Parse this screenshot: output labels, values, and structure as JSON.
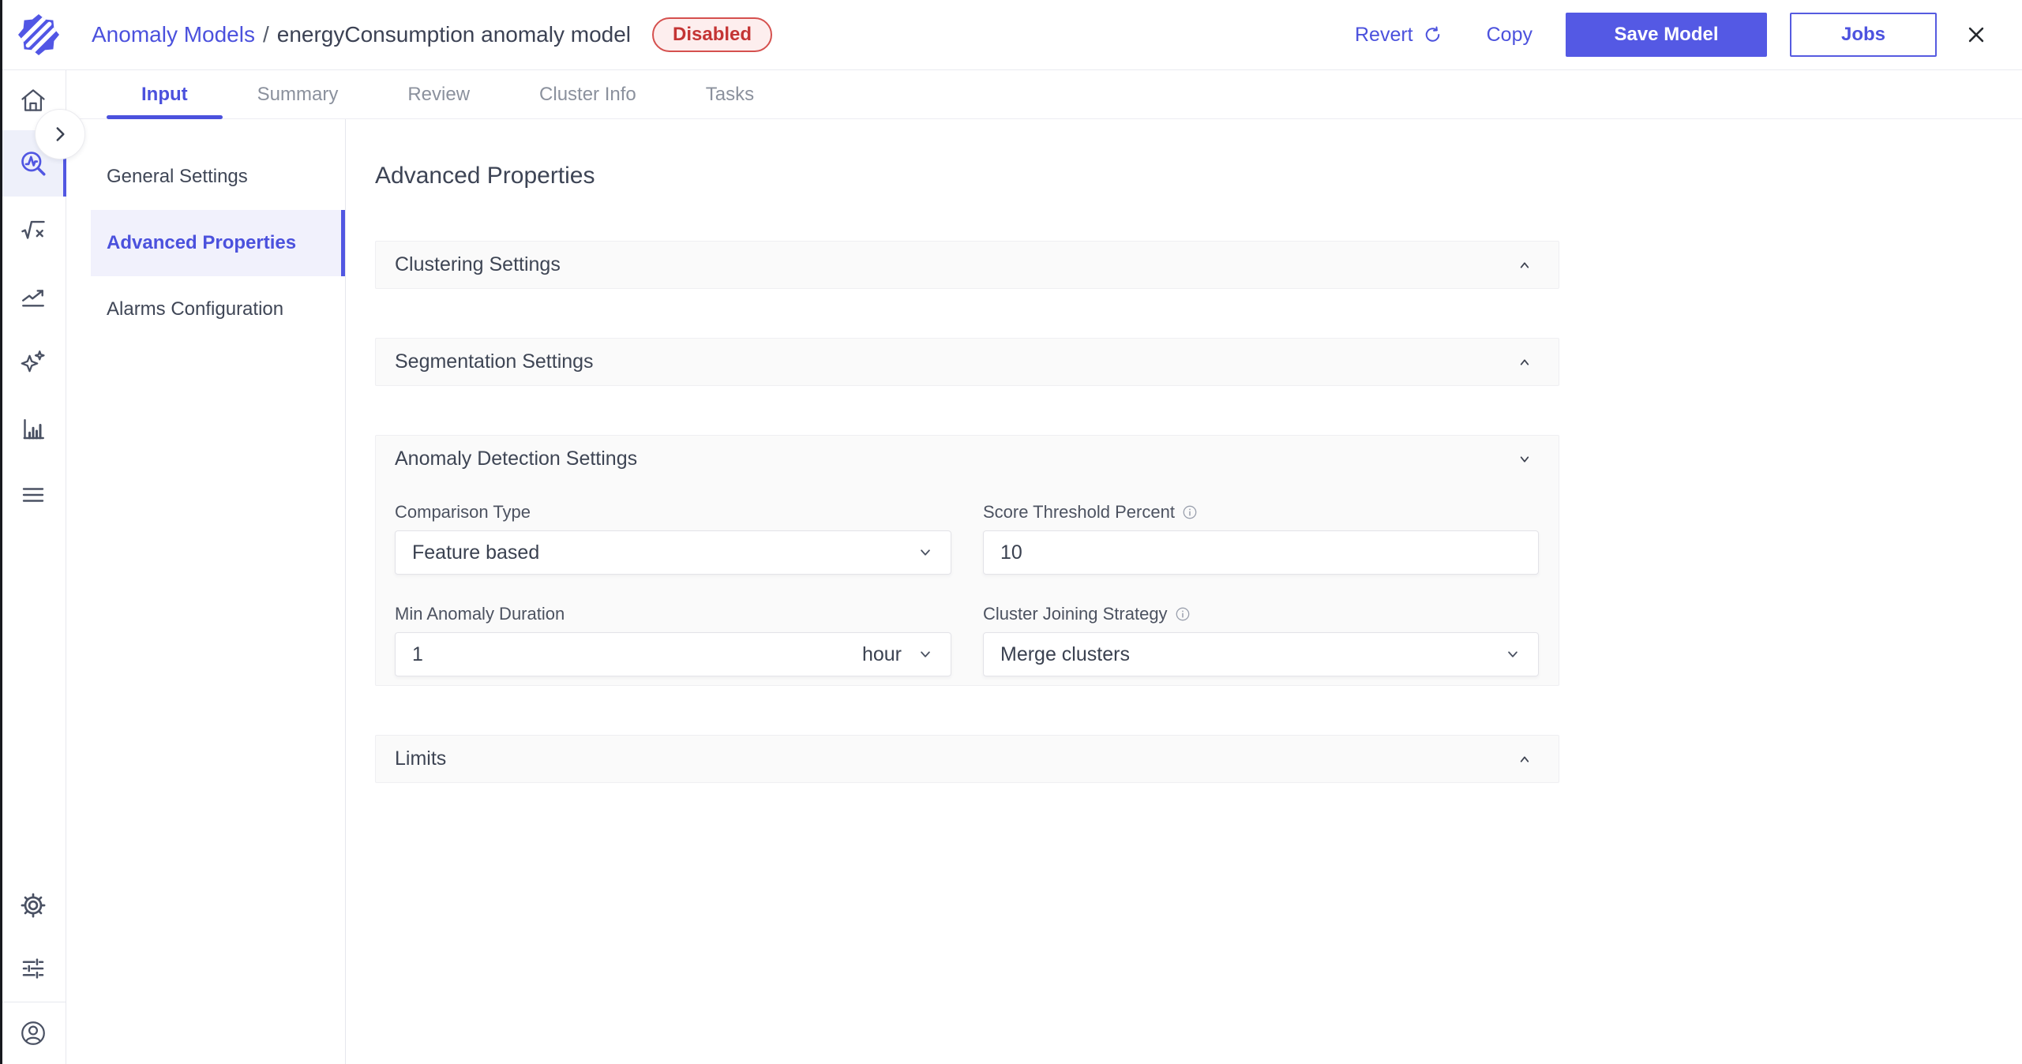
{
  "header": {
    "breadcrumb": {
      "parent": "Anomaly Models",
      "separator": "/",
      "current": "energyConsumption anomaly model"
    },
    "status_badge": "Disabled",
    "actions": {
      "revert": "Revert",
      "copy": "Copy",
      "save": "Save Model",
      "jobs": "Jobs"
    }
  },
  "tabs": [
    {
      "label": "Input",
      "active": true
    },
    {
      "label": "Summary",
      "active": false
    },
    {
      "label": "Review",
      "active": false
    },
    {
      "label": "Cluster Info",
      "active": false
    },
    {
      "label": "Tasks",
      "active": false
    }
  ],
  "sidebar": {
    "top_icons": [
      "home-icon",
      "anomaly-search-icon",
      "formula-icon",
      "trend-icon",
      "sparkles-icon",
      "bar-chart-icon",
      "menu-icon"
    ],
    "active_icon": "anomaly-search-icon",
    "bottom_icons": [
      "settings-gear-icon",
      "sliders-icon",
      "account-icon"
    ],
    "expand_icon": "chevron-right-icon"
  },
  "subnav": {
    "items": [
      {
        "label": "General Settings",
        "active": false
      },
      {
        "label": "Advanced Properties",
        "active": true
      },
      {
        "label": "Alarms Configuration",
        "active": false
      }
    ]
  },
  "main": {
    "title": "Advanced Properties",
    "sections": [
      {
        "title": "Clustering Settings",
        "expanded": false
      },
      {
        "title": "Segmentation Settings",
        "expanded": false
      },
      {
        "title": "Anomaly Detection Settings",
        "expanded": true,
        "fields": [
          {
            "label": "Comparison Type",
            "type": "select",
            "value": "Feature based",
            "info": false
          },
          {
            "label": "Score Threshold Percent",
            "type": "input",
            "value": "10",
            "info": true
          },
          {
            "label": "Min Anomaly Duration",
            "type": "input-unit",
            "value": "1",
            "unit": "hour",
            "info": false
          },
          {
            "label": "Cluster Joining Strategy",
            "type": "select",
            "value": "Merge clusters",
            "info": true
          }
        ]
      },
      {
        "title": "Limits",
        "expanded": false
      }
    ]
  },
  "colors": {
    "accent": "#5157e2",
    "link": "#4b51dd",
    "badge_text": "#c43434",
    "badge_bg": "#fdeeee",
    "badge_border": "#d5504e",
    "panel_bg": "#fafafa",
    "active_nav_bg": "#f1f1fc"
  }
}
